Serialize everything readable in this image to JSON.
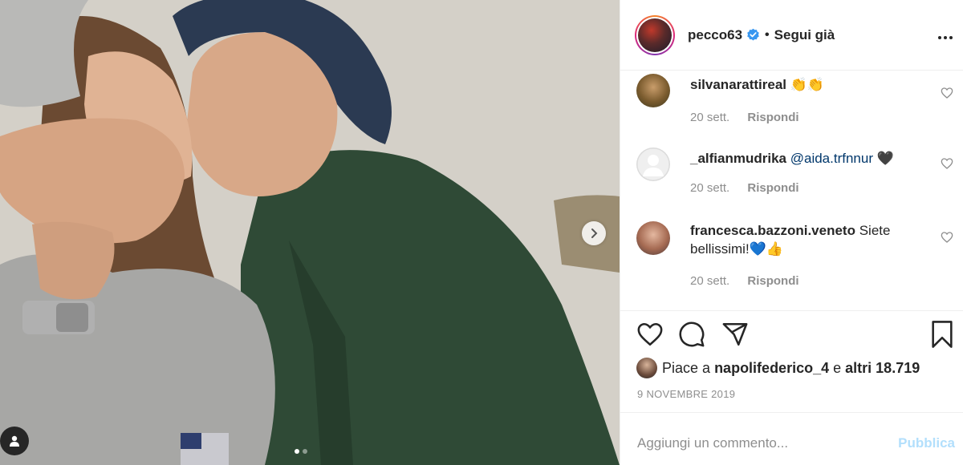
{
  "post": {
    "username": "pecco63",
    "separator": "•",
    "follow_label": "Segui già",
    "more_label": "···"
  },
  "colors": {
    "link": "#00376b",
    "muted": "#8e8e8e",
    "publish_disabled": "#b2dffc",
    "verified": "#3897f0"
  },
  "carousel": {
    "slides": 2,
    "active": 1
  },
  "comments": [
    {
      "user": "silvanarattireal",
      "text": "👏👏",
      "mention": "",
      "time": "20 sett.",
      "reply": "Rispondi",
      "avatar": "photo"
    },
    {
      "user": "_alfianmudrika",
      "text": "🖤",
      "mention": "@aida.trfnnur",
      "time": "20 sett.",
      "reply": "Rispondi",
      "avatar": "default"
    },
    {
      "user": "francesca.bazzoni.veneto",
      "text": "Siete bellissimi!💙👍",
      "mention": "",
      "time": "20 sett.",
      "reply": "Rispondi",
      "avatar": "photo"
    }
  ],
  "likes": {
    "prefix": "Piace a",
    "user": "napolifederico_4",
    "middle": "e",
    "others": "altri 18.719"
  },
  "date": "9 NOVEMBRE 2019",
  "add_comment": {
    "placeholder": "Aggiungi un commento...",
    "publish_label": "Pubblica"
  },
  "icons": [
    "next-arrow-icon",
    "user-tag-icon",
    "verified-badge-icon",
    "heart-icon",
    "comment-icon",
    "share-icon",
    "bookmark-icon",
    "more-icon"
  ]
}
